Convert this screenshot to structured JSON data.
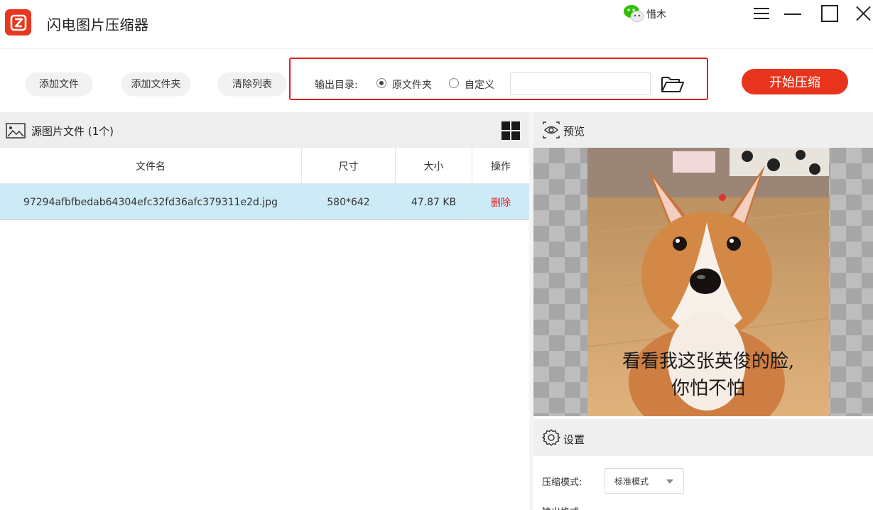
{
  "app": {
    "title": "闪电图片压缩器"
  },
  "user": {
    "name": "惜木"
  },
  "toolbar": {
    "add_file": "添加文件",
    "add_folder": "添加文件夹",
    "clear_list": "清除列表",
    "output_label": "输出目录:",
    "option_source": "原文件夹",
    "option_custom": "自定义",
    "output_path": "",
    "selected_option": "原文件夹",
    "start": "开始压缩"
  },
  "files": {
    "header": "源图片文件 (1个)",
    "columns": [
      "文件名",
      "尺寸",
      "大小",
      "操作"
    ],
    "rows": [
      {
        "name": "97294afbfbedab64304efc32fd36afc379311e2d.jpg",
        "dimensions": "580*642",
        "size": "47.87 KB",
        "action": "删除"
      }
    ]
  },
  "preview": {
    "header": "预览",
    "caption_line1": "看看我这张英俊的脸,",
    "caption_line2": "你怕不怕"
  },
  "settings": {
    "header": "设置",
    "mode_label": "压缩模式:",
    "mode_value": "标准模式",
    "next_label": "输出格式:"
  },
  "colors": {
    "accent": "#e8341c",
    "selected_row": "#cdebf7",
    "highlight_border": "#e02020"
  }
}
